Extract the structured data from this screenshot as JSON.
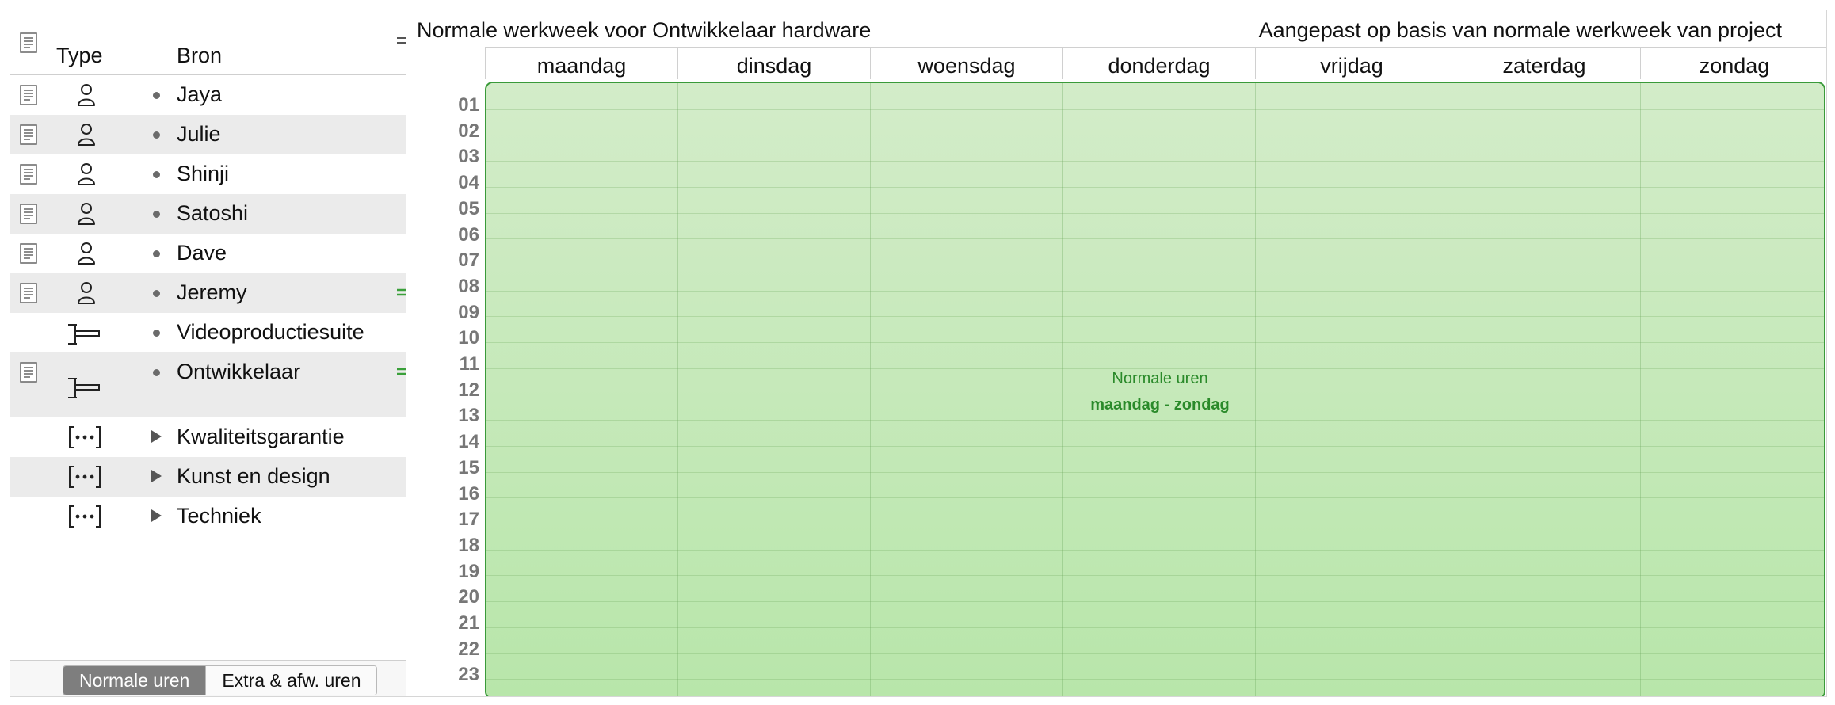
{
  "sidebar": {
    "columns": {
      "type": "Type",
      "source": "Bron"
    },
    "items": [
      {
        "label": "Jaya",
        "kind": "person-icon",
        "has_note": true,
        "marker": "bullet",
        "alt": false,
        "handle": false
      },
      {
        "label": "Julie",
        "kind": "person-icon",
        "has_note": true,
        "marker": "bullet",
        "alt": true,
        "handle": false
      },
      {
        "label": "Shinji",
        "kind": "person-icon",
        "has_note": true,
        "marker": "bullet",
        "alt": false,
        "handle": false
      },
      {
        "label": "Satoshi",
        "kind": "person-icon",
        "has_note": true,
        "marker": "bullet",
        "alt": true,
        "handle": false
      },
      {
        "label": "Dave",
        "kind": "person-icon",
        "has_note": true,
        "marker": "bullet",
        "alt": false,
        "handle": false
      },
      {
        "label": "Jeremy",
        "kind": "person-icon",
        "has_note": true,
        "marker": "bullet",
        "alt": true,
        "handle": true
      },
      {
        "label": "Videoproductiesuite",
        "kind": "equipment-icon",
        "has_note": false,
        "marker": "bullet",
        "alt": false,
        "handle": false
      },
      {
        "label": "Ontwikkelaar",
        "kind": "equipment-icon",
        "has_note": true,
        "marker": "bullet",
        "alt": true,
        "handle": true
      },
      {
        "label": "Kwaliteitsgarantie",
        "kind": "group-icon",
        "has_note": false,
        "marker": "disclosure",
        "alt": false,
        "handle": false
      },
      {
        "label": "Kunst en design",
        "kind": "group-icon",
        "has_note": false,
        "marker": "disclosure",
        "alt": true,
        "handle": false
      },
      {
        "label": "Techniek",
        "kind": "group-icon",
        "has_note": false,
        "marker": "disclosure",
        "alt": false,
        "handle": false
      }
    ],
    "footer": {
      "tab_normal": "Normale uren",
      "tab_extra": "Extra & afw. uren"
    }
  },
  "calendar": {
    "title": "Normale werkweek voor Ontwikkelaar hardware",
    "subtitle": "Aangepast op basis van normale werkweek van project",
    "days": [
      "maandag",
      "dinsdag",
      "woensdag",
      "donderdag",
      "vrijdag",
      "zaterdag",
      "zondag"
    ],
    "hours": [
      "01",
      "02",
      "03",
      "04",
      "05",
      "06",
      "07",
      "08",
      "09",
      "10",
      "11",
      "12",
      "13",
      "14",
      "15",
      "16",
      "17",
      "18",
      "19",
      "20",
      "21",
      "22",
      "23"
    ],
    "block": {
      "caption": "Normale uren",
      "range": "maandag - zondag"
    }
  },
  "colors": {
    "block_fill": "#b6e6a8",
    "block_border": "#3a9a3a",
    "block_text": "#2a8a2a",
    "hour_text": "#777777",
    "handle": "#3aa03a"
  }
}
